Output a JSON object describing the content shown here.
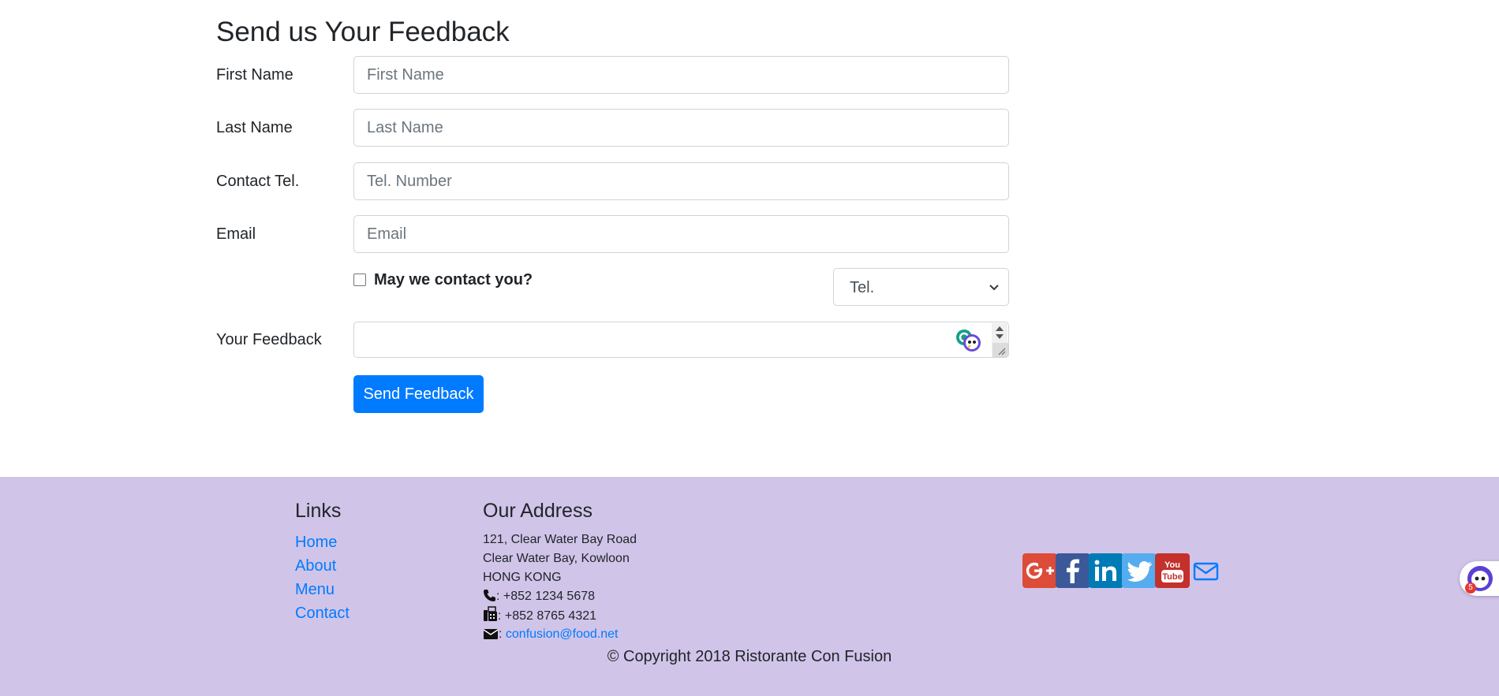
{
  "form": {
    "title": "Send us Your Feedback",
    "fields": [
      {
        "label": "First Name",
        "placeholder": "First Name"
      },
      {
        "label": "Last Name",
        "placeholder": "Last Name"
      },
      {
        "label": "Contact Tel.",
        "placeholder": "Tel. Number"
      },
      {
        "label": "Email",
        "placeholder": "Email"
      }
    ],
    "contact_checkbox_label": "May we contact you?",
    "contact_select_value": "Tel.",
    "feedback_label": "Your Feedback",
    "submit_label": "Send Feedback"
  },
  "footer": {
    "links_title": "Links",
    "links": [
      "Home",
      "About",
      "Menu",
      "Contact"
    ],
    "address_title": "Our Address",
    "address_lines": [
      "121, Clear Water Bay Road",
      "Clear Water Bay, Kowloon",
      "HONG KONG"
    ],
    "phone": ": +852 1234 5678",
    "fax": ": +852 8765 4321",
    "email_sep": ":",
    "email": "confusion@food.net",
    "copyright": "© Copyright 2018 Ristorante Con Fusion",
    "social": [
      {
        "icon": "google-plus-icon",
        "color": "#dd4b39"
      },
      {
        "icon": "facebook-icon",
        "color": "#3b5998"
      },
      {
        "icon": "linkedin-icon",
        "color": "#007bb6"
      },
      {
        "icon": "twitter-icon",
        "color": "#55acee"
      },
      {
        "icon": "youtube-icon",
        "color": "#bb0000"
      },
      {
        "icon": "mail-icon",
        "color": "#007bff"
      }
    ]
  },
  "chat_widget": {
    "badge_count": "5"
  },
  "colors": {
    "primary": "#007bff",
    "footer_bg": "#d1c4e9"
  }
}
